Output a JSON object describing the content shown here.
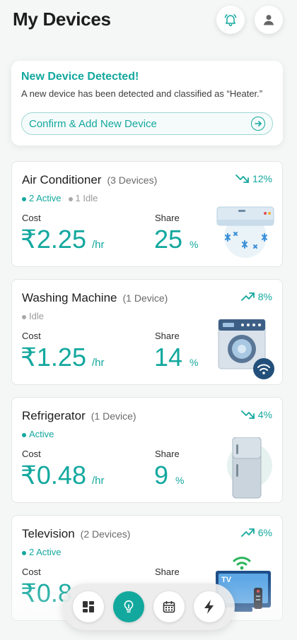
{
  "header": {
    "title": "My Devices",
    "notifications_icon": "bell-icon",
    "profile_icon": "user-icon"
  },
  "alert": {
    "title": "New Device Detected!",
    "message": "A new device has been detected and classified as “Heater.”",
    "button_label": "Confirm & Add New Device",
    "button_icon": "arrow-right-circle-icon"
  },
  "labels": {
    "cost": "Cost",
    "share": "Share"
  },
  "devices": [
    {
      "name": "Air Conditioner",
      "count": "(3 Devices)",
      "trend": "12%",
      "trend_dir": "down",
      "active": "2 Active",
      "idle": "1 Idle",
      "cost": "₹2.25",
      "cost_unit": "/hr",
      "share": "25",
      "share_unit": "%",
      "icon": "air-conditioner-icon"
    },
    {
      "name": "Washing Machine",
      "count": "(1 Device)",
      "trend": "8%",
      "trend_dir": "up",
      "idle": "Idle",
      "cost": "₹1.25",
      "cost_unit": "/hr",
      "share": "14",
      "share_unit": "%",
      "icon": "washing-machine-icon"
    },
    {
      "name": "Refrigerator",
      "count": "(1 Device)",
      "trend": "4%",
      "trend_dir": "down",
      "active": "Active",
      "cost": "₹0.48",
      "cost_unit": "/hr",
      "share": "9",
      "share_unit": "%",
      "icon": "refrigerator-icon"
    },
    {
      "name": "Television",
      "count": "(2 Devices)",
      "trend": "6%",
      "trend_dir": "up",
      "active": "2 Active",
      "cost": "₹0.8",
      "cost_unit": "",
      "share": "",
      "share_unit": "",
      "icon": "television-icon",
      "screen_text": "TV"
    }
  ],
  "nav": {
    "items": [
      "dashboard-icon",
      "lightbulb-icon",
      "calendar-icon",
      "lightning-icon"
    ],
    "active": "lightbulb-icon"
  },
  "colors": {
    "accent": "#13a89e",
    "idle": "#a8a8a8",
    "background": "#f5f7f6"
  }
}
